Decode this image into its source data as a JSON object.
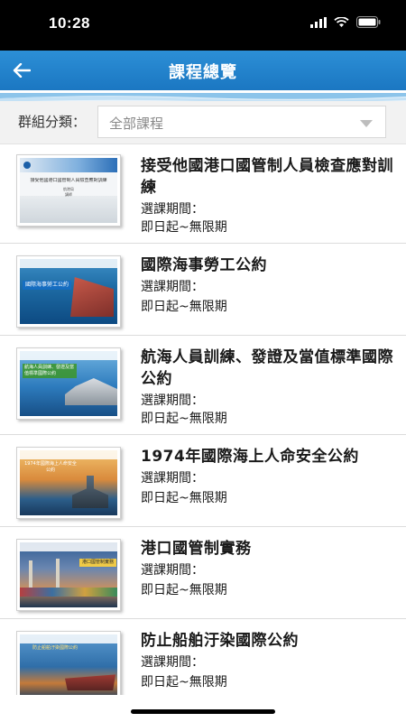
{
  "status_bar": {
    "time": "10:28"
  },
  "header": {
    "title": "課程總覽"
  },
  "filter": {
    "label": "群組分類：",
    "value": "全部課程"
  },
  "courses": [
    {
      "title": "接受他國港口國管制人員檢查應對訓練",
      "period_label": "選課期間：",
      "period_value": "即日起~無限期",
      "thumb_text": "接受他國港口國管制人員檢查應對訓練",
      "thumb_sub1": "航港局",
      "thumb_sub2": "講師"
    },
    {
      "title": "國際海事勞工公約",
      "period_label": "選課期間：",
      "period_value": "即日起~無限期",
      "thumb_text": "國際海事勞工公約"
    },
    {
      "title": "航海人員訓練、發證及當值標準國際公約",
      "period_label": "選課期間：",
      "period_value": "即日起~無限期",
      "thumb_text": "航海人員訓練、發證及當值標準國際公約"
    },
    {
      "title": "1974年國際海上人命安全公約",
      "period_label": "選課期間：",
      "period_value": "即日起~無限期",
      "thumb_text": "1974年國際海上人命安全公約"
    },
    {
      "title": "港口國管制實務",
      "period_label": "選課期間：",
      "period_value": "即日起~無限期",
      "thumb_text": "港口國管制實務"
    },
    {
      "title": "防止船舶汙染國際公約",
      "period_label": "選課期間：",
      "period_value": "即日起~無限期",
      "thumb_text": "防止船舶汙染國際公約"
    }
  ],
  "colors": {
    "nav": "#1b77c2",
    "text": "#1a1a1a"
  }
}
